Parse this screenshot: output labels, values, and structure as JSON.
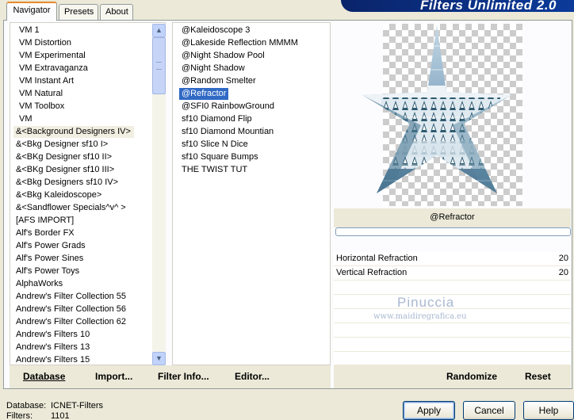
{
  "tabs": [
    {
      "label": "Navigator",
      "active": true
    },
    {
      "label": "Presets",
      "active": false
    },
    {
      "label": "About",
      "active": false
    }
  ],
  "banner": {
    "title": "Filters Unlimited 2.0"
  },
  "categories": [
    "VM 1",
    "VM Distortion",
    "VM Experimental",
    "VM Extravaganza",
    "VM Instant Art",
    "VM Natural",
    "VM Toolbox",
    "VM",
    "&<Background Designers IV>",
    "&<Bkg Designer sf10 I>",
    "&<BKg Designer sf10 II>",
    "&<BKg Designer sf10 III>",
    "&<Bkg Designers sf10 IV>",
    "&<Bkg Kaleidoscope>",
    "&<Sandflower Specials^v^ >",
    "[AFS IMPORT]",
    "Alf's Border FX",
    "Alf's Power Grads",
    "Alf's Power Sines",
    "Alf's Power Toys",
    "AlphaWorks",
    "Andrew's Filter Collection 55",
    "Andrew's Filter Collection 56",
    "Andrew's Filter Collection 62",
    "Andrew's Filters 10",
    "Andrew's Filters 13",
    "Andrew's Filters 15"
  ],
  "selected_category": "&<Background Designers IV>",
  "filters": [
    "@Kaleidoscope 3",
    "@Lakeside Reflection MMMM",
    "@Night Shadow Pool",
    "@Night Shadow",
    "@Random Smelter",
    "@Refractor",
    "@SFI0 RainbowGround",
    "sf10 Diamond Flip",
    "sf10 Diamond Mountian",
    "sf10 Slice N Dice",
    "sf10 Square Bumps",
    "THE TWIST TUT"
  ],
  "selected_filter": "@Refractor",
  "preview": {
    "filter_name": "@Refractor",
    "progress": 0
  },
  "params": [
    {
      "label": "Horizontal Refraction",
      "value": "20"
    },
    {
      "label": "Vertical Refraction",
      "value": "20"
    }
  ],
  "watermark": {
    "name": "Pinuccia",
    "url": "www.maidiregrafica.eu"
  },
  "buttons": {
    "database": "Database",
    "import": "Import...",
    "filter_info": "Filter Info...",
    "editor": "Editor...",
    "randomize": "Randomize",
    "reset": "Reset",
    "apply": "Apply",
    "cancel": "Cancel",
    "help": "Help"
  },
  "info": {
    "database_label": "Database:",
    "database_value": "ICNET-Filters",
    "filters_label": "Filters:",
    "filters_value": "1101"
  },
  "colors": {
    "selection": "#316ac5",
    "banner": "#0a246a",
    "tab_accent": "#e68b2c"
  }
}
